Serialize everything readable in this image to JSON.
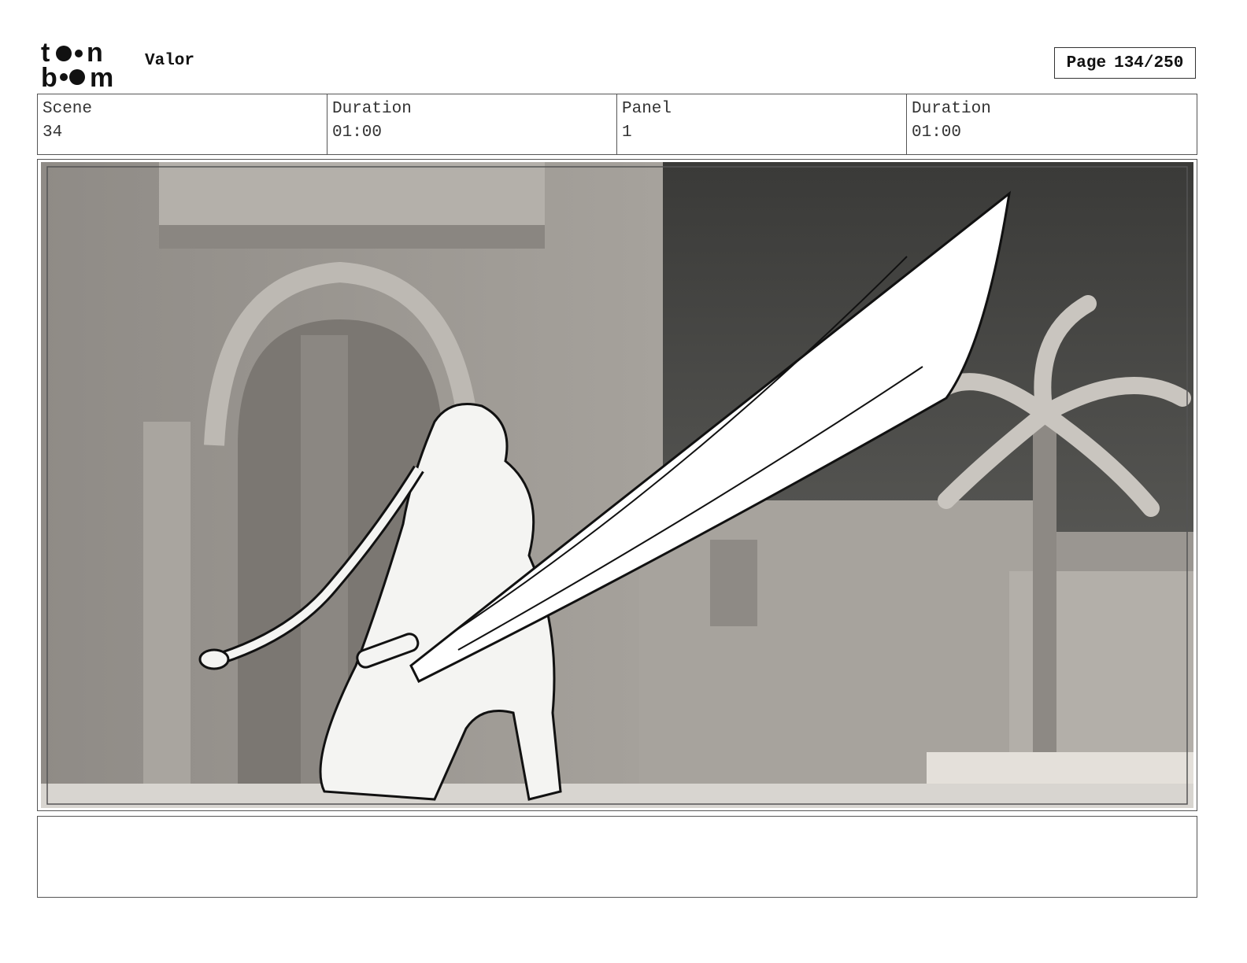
{
  "header": {
    "logo_text_line1": "toon",
    "logo_text_line2": "boom",
    "project_title": "Valor",
    "page_label": "Page",
    "page_number": "134/250"
  },
  "info": {
    "scene_label": "Scene",
    "scene_value": "34",
    "duration_label": "Duration",
    "duration_value": "01:00",
    "panel_label": "Panel",
    "panel_value": "1",
    "panel_duration_label": "Duration",
    "panel_duration_value": "01:00"
  },
  "notes": {
    "text": ""
  }
}
